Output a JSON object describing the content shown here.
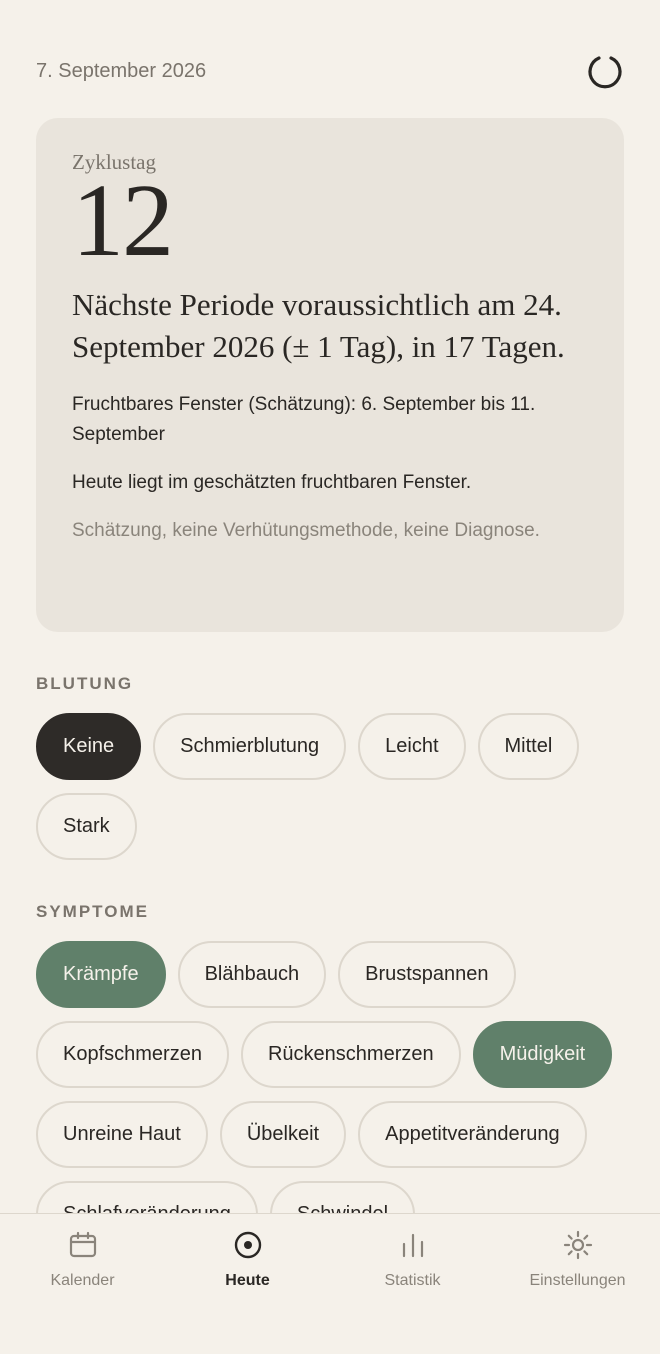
{
  "header": {
    "date": "7. September 2026",
    "sync_icon": "sync-spinner-icon"
  },
  "card": {
    "cycle_label": "Zyklustag",
    "cycle_day": "12",
    "next_period": "Nächste Periode voraussichtlich am 24. September 2026 (± 1 Tag), in 17 Tagen.",
    "fertile_window": "Fruchtbares Fenster (Schätzung): 6. September bis 11. September",
    "today_note": "Heute liegt im geschätzten fruchtbaren Fenster.",
    "disclaimer": "Schätzung, keine Verhütungsmethode, keine Diagnose."
  },
  "bleeding": {
    "title": "BLUTUNG",
    "options": [
      "Keine",
      "Schmierblutung",
      "Leicht",
      "Mittel",
      "Stark"
    ],
    "selected": "Keine"
  },
  "symptoms": {
    "title": "SYMPTOME",
    "options": [
      "Krämpfe",
      "Blähbauch",
      "Brustspannen",
      "Kopfschmerzen",
      "Rückenschmerzen",
      "Müdigkeit",
      "Unreine Haut",
      "Übelkeit",
      "Appetitveränderung",
      "Schlafveränderung",
      "Schwindel"
    ],
    "selected": [
      "Krämpfe",
      "Müdigkeit"
    ]
  },
  "colors": {
    "background": "#f5f1ea",
    "card": "#e9e4dc",
    "selected_dark": "#2e2b28",
    "selected_green": "#60806a"
  },
  "tabs": [
    {
      "label": "Kalender",
      "icon": "calendar-icon",
      "active": false
    },
    {
      "label": "Heute",
      "icon": "target-circle-icon",
      "active": true
    },
    {
      "label": "Statistik",
      "icon": "bar-chart-icon",
      "active": false
    },
    {
      "label": "Einstellungen",
      "icon": "sun-gear-icon",
      "active": false
    }
  ]
}
